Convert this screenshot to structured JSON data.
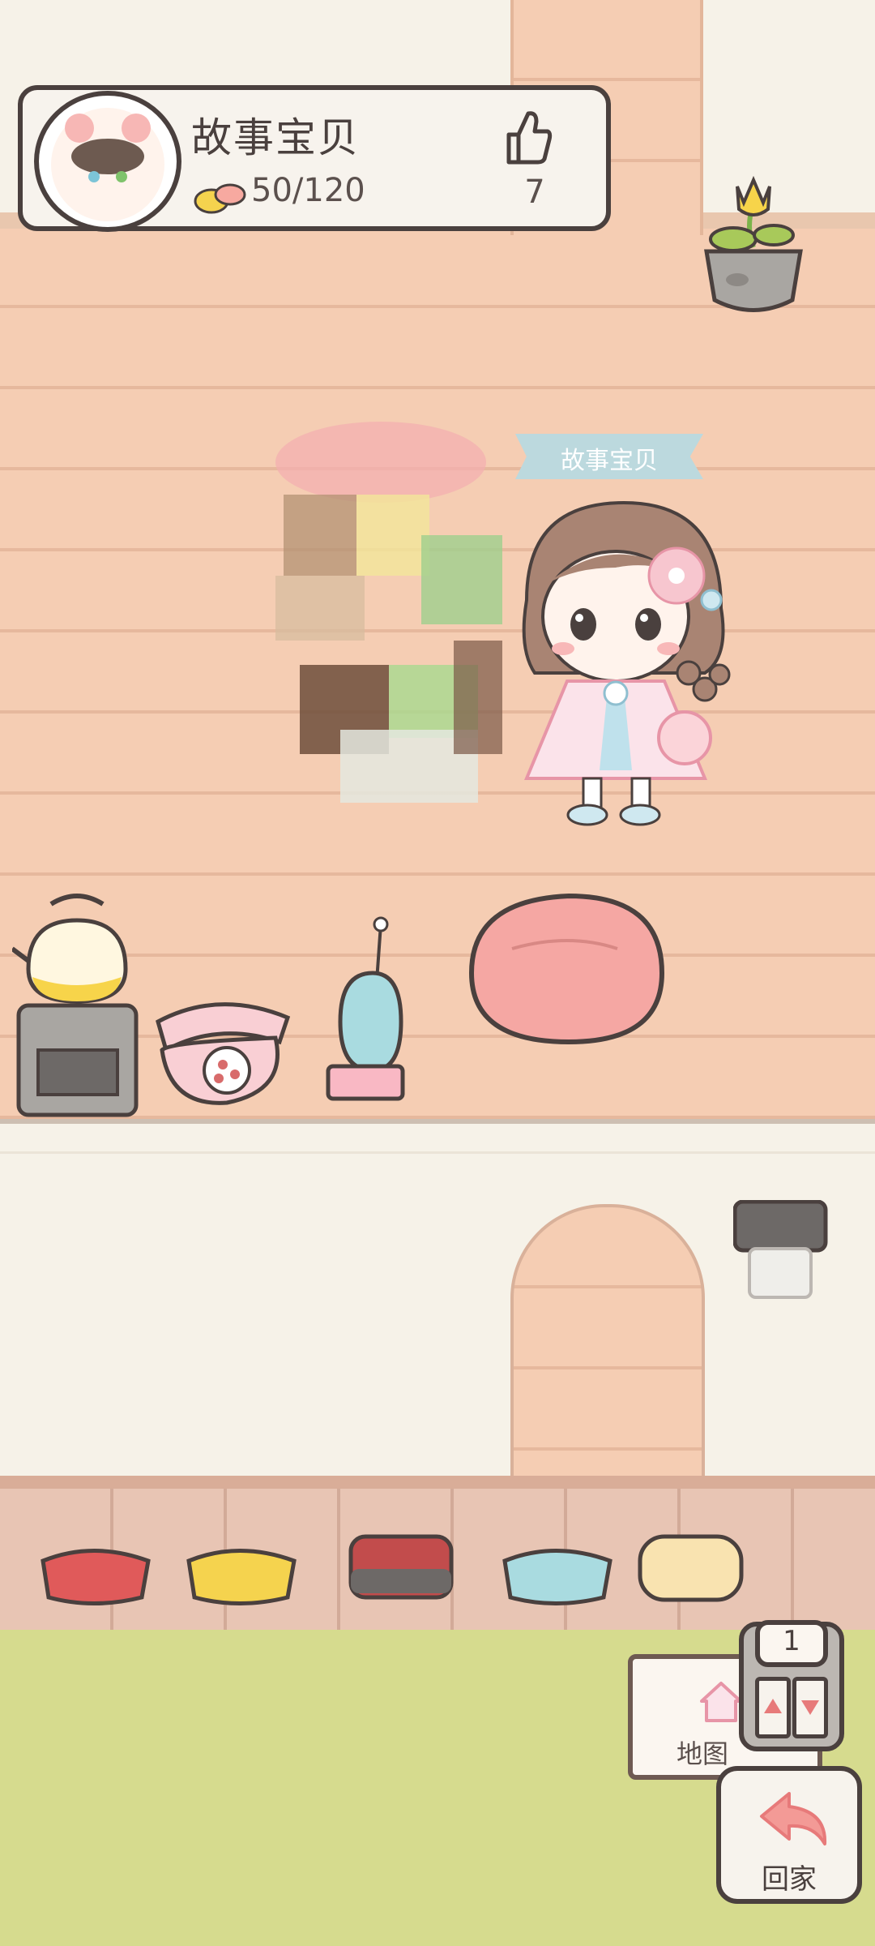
{
  "profile": {
    "name": "故事宝贝",
    "currency": "50/120",
    "likes": "7"
  },
  "scene": {
    "character_tag": "故事宝贝",
    "furniture_upper": [
      "kettle-stove",
      "rotary-phone",
      "radio",
      "bean-bag",
      "potted-tulip"
    ],
    "pet_bowls": [
      "red-bowl",
      "yellow-bowl",
      "dark-red-bowl",
      "blue-bowl",
      "cream-bowl"
    ],
    "wall_lamp": "wall-lamp"
  },
  "controls": {
    "floor_number": "1",
    "map_label": "地图",
    "home_label": "回家"
  },
  "colors": {
    "brick": "#f5cdb3",
    "outline": "#4a403e",
    "grass": "#d6db8e",
    "tag": "#bcd9de"
  }
}
